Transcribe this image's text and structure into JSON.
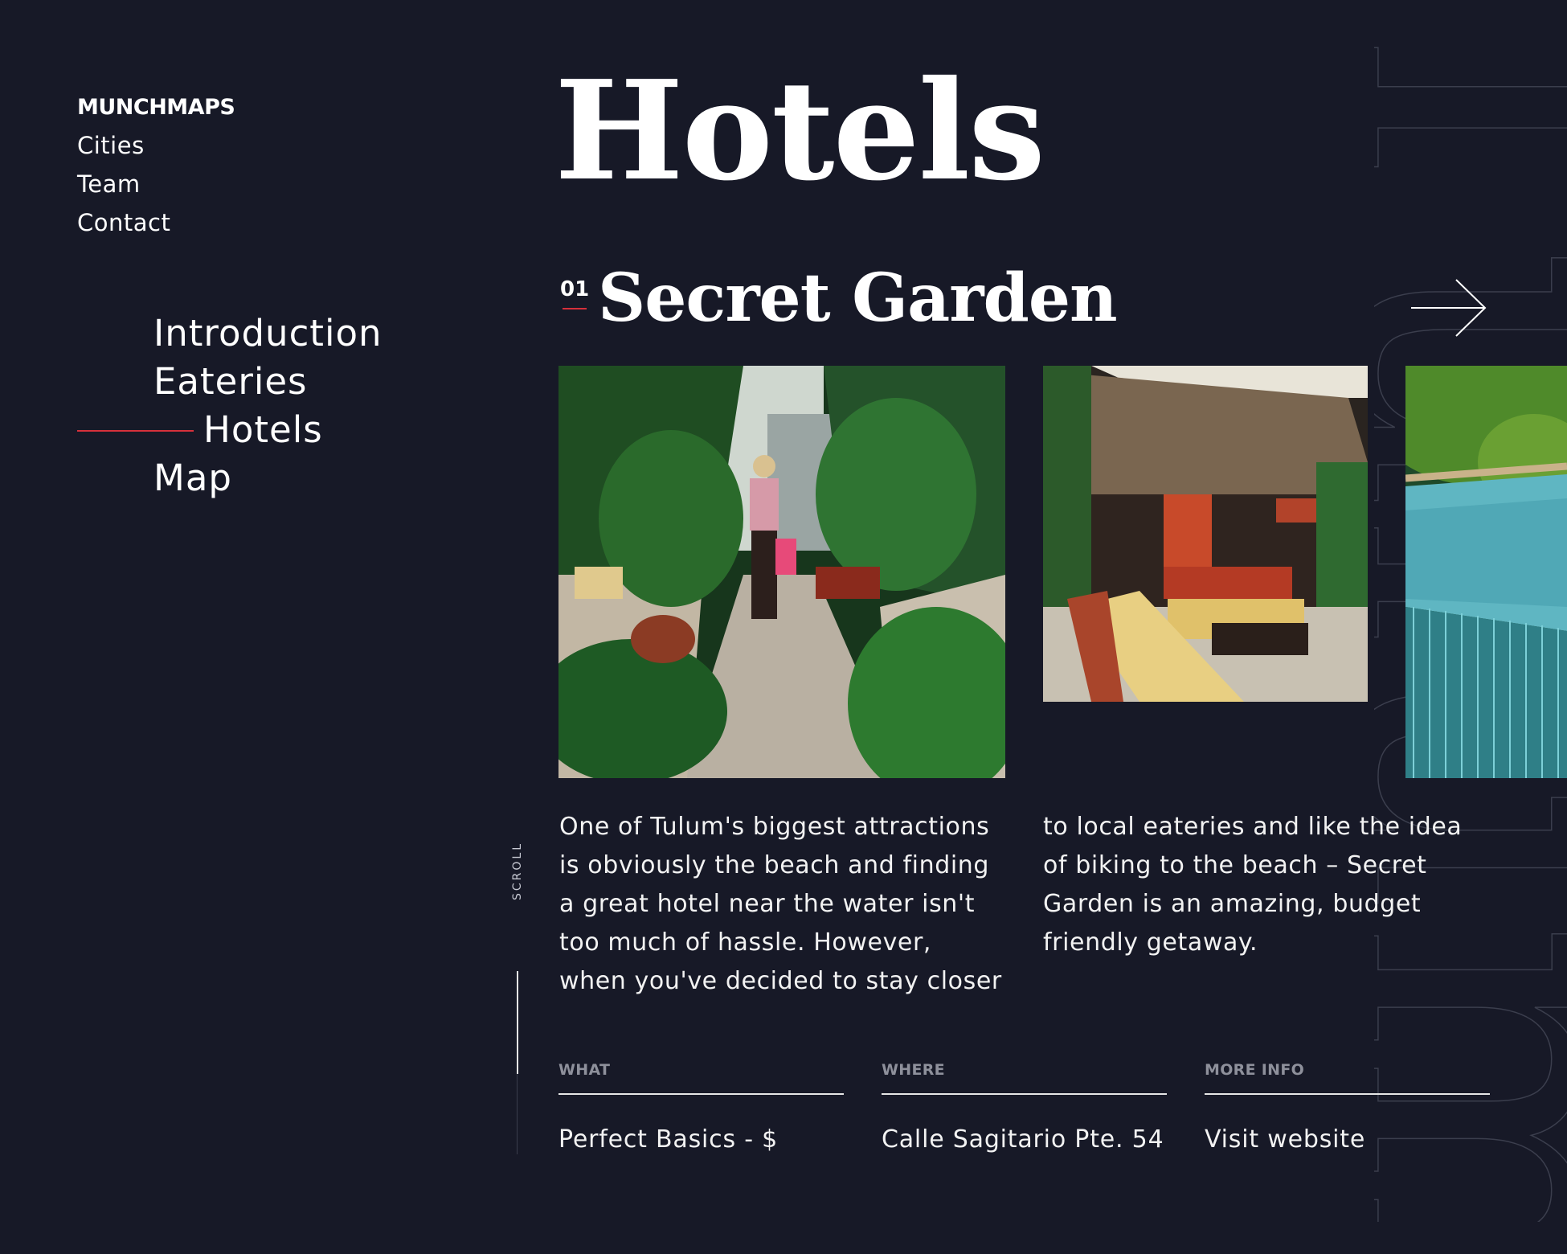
{
  "brand": {
    "logo": "MUNCHMAPS"
  },
  "top_nav": [
    "Cities",
    "Team",
    "Contact"
  ],
  "section_nav": {
    "items": [
      "Introduction",
      "Eateries",
      "Hotels",
      "Map"
    ],
    "active": "Hotels"
  },
  "scroll": {
    "label": "SCROLL"
  },
  "page": {
    "title": "Hotels"
  },
  "item": {
    "number": "01",
    "title": "Secret Garden",
    "images": [
      "garden-path-photo",
      "thatched-cabin-patio-photo",
      "turquoise-hammock-photo"
    ],
    "description_col1": "One of Tulum's biggest attractions\nis obviously the beach and finding\na great hotel near the water isn't\ntoo much of hassle. However,\nwhen you've decided to stay closer",
    "description_col2": "to local eateries and like the idea\nof biking to the beach – Secret\nGarden is an amazing, budget\nfriendly getaway.",
    "info": {
      "what_label": "WHAT",
      "what_value": "Perfect Basics - $",
      "where_label": "WHERE",
      "where_value": "Calle Sagitario Pte. 54",
      "more_label": "MORE INFO",
      "more_value": "Visit website"
    }
  },
  "icons": {
    "next": "arrow-right-icon"
  },
  "colors": {
    "background": "#171927",
    "accent": "#d6303b",
    "text": "#ffffff",
    "muted": "#8e909b"
  }
}
